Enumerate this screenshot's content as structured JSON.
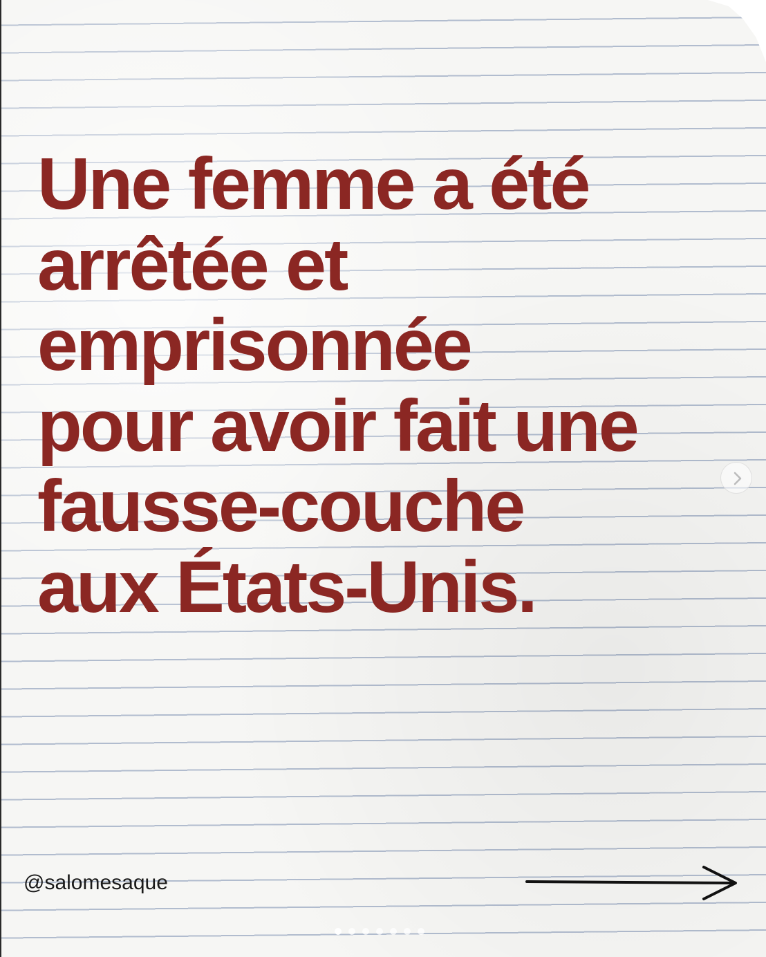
{
  "post": {
    "headline_lines": [
      "Une femme a été",
      "arrêtée et",
      "emprisonnée",
      "pour avoir fait une",
      "fausse-couche",
      "aux États-Unis."
    ],
    "handle": "@salomesaque"
  },
  "carousel": {
    "next_icon": "chevron-right-icon",
    "arrow_icon": "arrow-right-icon",
    "slide_count": 7,
    "current_slide": 1
  },
  "colors": {
    "headline": "#8b2723",
    "handle": "#1a1a1a",
    "paper": "#f6f6f4",
    "ruled_line": "#788caf"
  }
}
